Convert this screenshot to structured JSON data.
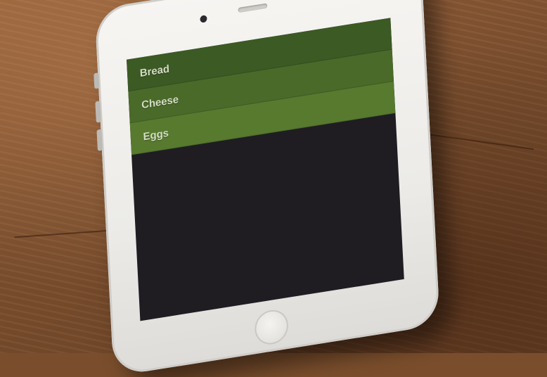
{
  "colors": {
    "row_1": "#3c5a24",
    "row_2": "#4a6a2a",
    "row_3": "#577a2f",
    "screen_bg": "#1f1d22",
    "phone_body": "#f2f1ee"
  },
  "list": {
    "items": [
      {
        "label": "Bread"
      },
      {
        "label": "Cheese"
      },
      {
        "label": "Eggs"
      }
    ]
  }
}
